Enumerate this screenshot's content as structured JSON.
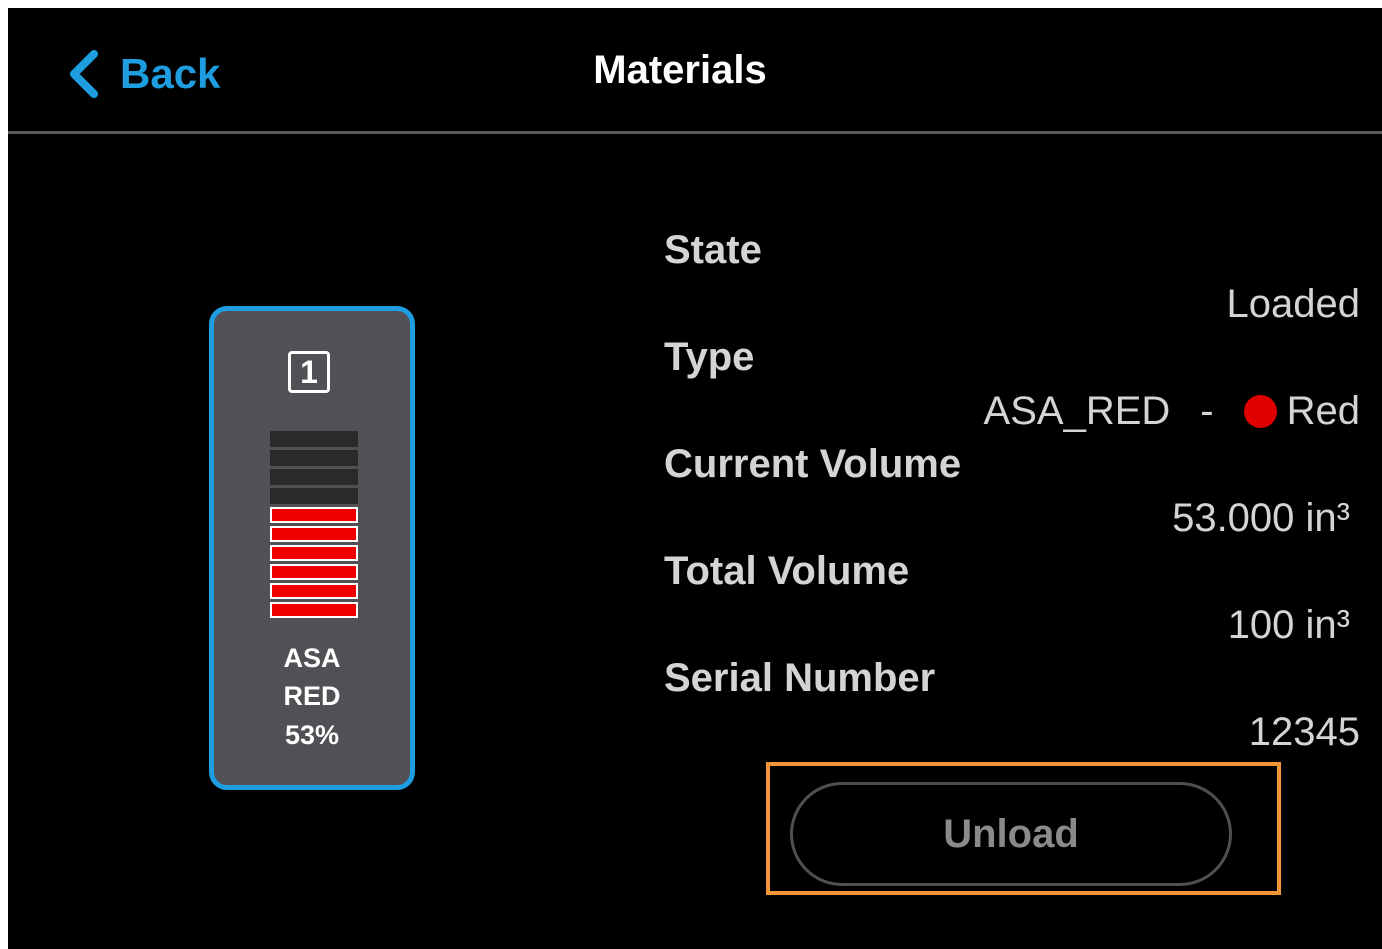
{
  "header": {
    "back_label": "Back",
    "title": "Materials"
  },
  "cartridge": {
    "slot": "1",
    "name_line1": "ASA",
    "name_line2": "RED",
    "percent": "53%",
    "level_fraction": 0.53,
    "color": "#ee0000",
    "accent": "#1e9ee0"
  },
  "details": {
    "state_label": "State",
    "state_value": "Loaded",
    "type_label": "Type",
    "type_value": "ASA_RED",
    "type_separator": "-",
    "color_name": "Red",
    "current_volume_label": "Current Volume",
    "current_volume_value": "53.000 in³",
    "total_volume_label": "Total Volume",
    "total_volume_value": "100 in³",
    "serial_label": "Serial Number",
    "serial_value": "12345"
  },
  "actions": {
    "unload_label": "Unload"
  }
}
